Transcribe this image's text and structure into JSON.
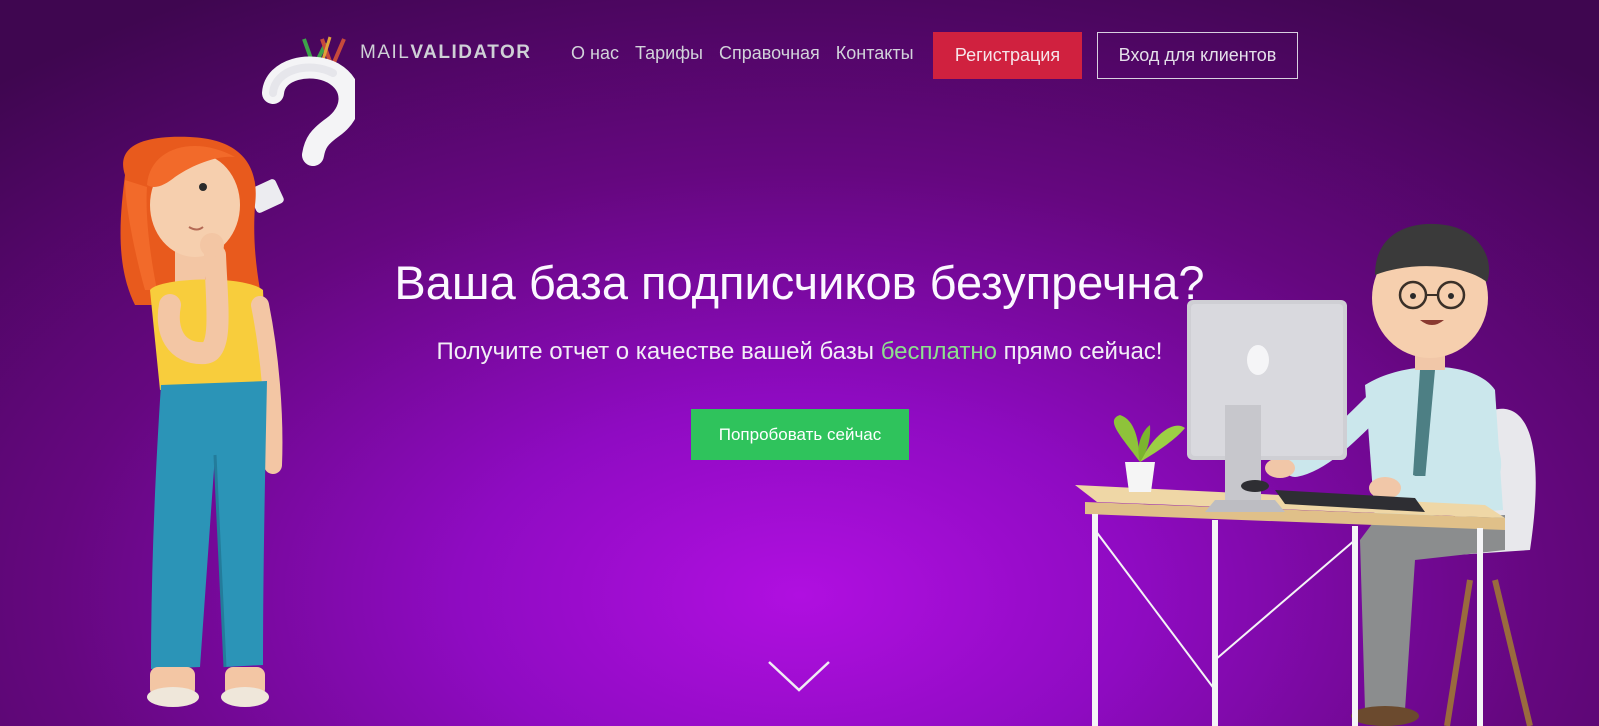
{
  "header": {
    "logo": {
      "prefix": "MAIL",
      "suffix": "VALIDATOR"
    },
    "nav": [
      {
        "label": "О нас"
      },
      {
        "label": "Тарифы"
      },
      {
        "label": "Справочная"
      },
      {
        "label": "Контакты"
      }
    ],
    "register_label": "Регистрация",
    "login_label": "Вход для клиентов"
  },
  "hero": {
    "title": "Ваша база подписчиков безупречна?",
    "subtitle_before": "Получите отчет о качестве вашей базы ",
    "subtitle_highlight": "бесплатно",
    "subtitle_after": " прямо сейчас!",
    "cta_label": "Попробовать сейчас"
  },
  "icons": {
    "logo_mark": "mailvalidator-logo-icon",
    "scroll_down": "chevron-down-icon"
  },
  "colors": {
    "brand_red": "#d0213f",
    "cta_green": "#2fc35c",
    "highlight_green": "#8ee08e",
    "bg_purple": "#8f0bc2"
  }
}
